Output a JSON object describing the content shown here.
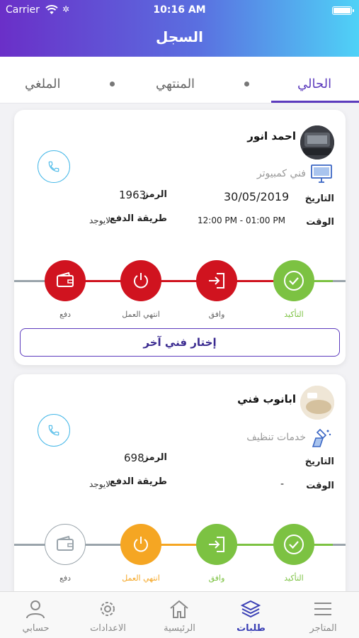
{
  "status_bar": {
    "carrier": "Carrier",
    "time": "10:16 AM"
  },
  "header": {
    "title": "السجل"
  },
  "tabs": [
    {
      "label": "الحالي",
      "active": true
    },
    {
      "label": "المنتهي",
      "active": false
    },
    {
      "label": "الملغي",
      "active": false
    }
  ],
  "colors": {
    "primary": "#5c3bbd",
    "green": "#7cc242",
    "red": "#d0131f",
    "orange": "#f5a623",
    "gray": "#9aa4ab"
  },
  "requests": [
    {
      "tech_name": "احمد انور",
      "service": "فني كمبيوتر",
      "service_icon": "monitor-icon",
      "date_label": "التاريخ",
      "date_value": "30/05/2019",
      "time_label": "الوقت",
      "time_value": "12:00 PM - 01:00 PM",
      "code_label": "الرمز",
      "code_value": "1963",
      "payment_label": "طريقة الدفع",
      "payment_value": "لايوجد",
      "steps": [
        {
          "label": "التأكيد",
          "state": "done-green",
          "icon": "check-icon"
        },
        {
          "label": "وافق",
          "state": "active-red",
          "icon": "signin-icon"
        },
        {
          "label": "انتهي العمل",
          "state": "active-red",
          "icon": "power-icon"
        },
        {
          "label": "دفع",
          "state": "active-red",
          "icon": "wallet-icon"
        }
      ],
      "alt_button": "إختار فني آخر"
    },
    {
      "tech_name": "ابانوب فني",
      "service": "خدمات تنظيف",
      "service_icon": "cleaning-icon",
      "date_label": "التاريخ",
      "date_value": "",
      "time_label": "الوقت",
      "time_value": "-",
      "code_label": "الرمز",
      "code_value": "698",
      "payment_label": "طريقة الدفع",
      "payment_value": "لايوجد",
      "steps": [
        {
          "label": "التأكيد",
          "state": "done-green",
          "icon": "check-icon"
        },
        {
          "label": "وافق",
          "state": "done-green",
          "icon": "signin-icon"
        },
        {
          "label": "انتهي العمل",
          "state": "active-orange",
          "icon": "power-icon"
        },
        {
          "label": "دفع",
          "state": "pending",
          "icon": "wallet-icon"
        }
      ]
    }
  ],
  "bottom_nav": [
    {
      "label": "المتاجر",
      "icon": "menu-icon",
      "active": false
    },
    {
      "label": "طلبات",
      "icon": "layers-icon",
      "active": true
    },
    {
      "label": "الرئيسية",
      "icon": "home-icon",
      "active": false
    },
    {
      "label": "الاعدادات",
      "icon": "gear-icon",
      "active": false
    },
    {
      "label": "حسابي",
      "icon": "user-icon",
      "active": false
    }
  ]
}
